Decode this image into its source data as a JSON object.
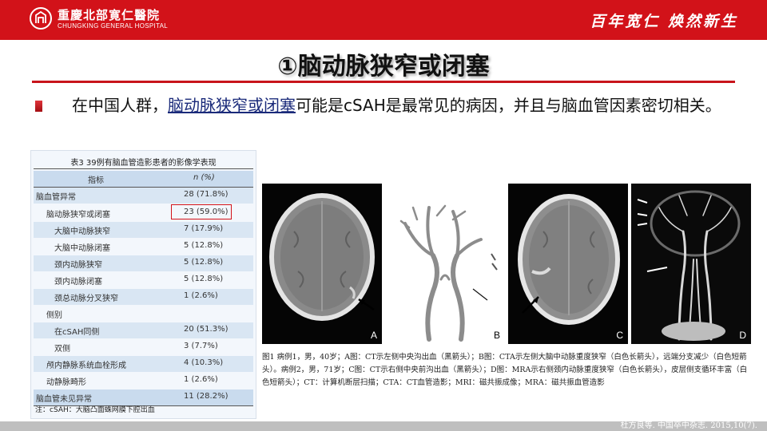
{
  "header": {
    "hospital_cn": "重慶北部寛仁醫院",
    "hospital_en": "CHUNGKING GENERAL HOSPITAL",
    "slogan": "百年宽仁  焕然新生"
  },
  "slide": {
    "title": "①脑动脉狭窄或闭塞",
    "bullet": {
      "pre": "在中国人群，",
      "highlight": "脑动脉狭窄或闭塞",
      "post": "可能是cSAH是最常见的病因，并且与脑血管因素密切相关。"
    }
  },
  "table": {
    "caption": "表3   39例有脑血管造影患者的影像学表现",
    "headers": [
      "指标",
      "n (%)"
    ],
    "rows": [
      {
        "label": "脑血管异常",
        "value": "28 (71.8%)"
      },
      {
        "label": "脑动脉狭窄或闭塞",
        "value": "23 (59.0%)"
      },
      {
        "label": "大脑中动脉狭窄",
        "value": "7 (17.9%)"
      },
      {
        "label": "大脑中动脉闭塞",
        "value": "5 (12.8%)"
      },
      {
        "label": "颈内动脉狭窄",
        "value": "5 (12.8%)"
      },
      {
        "label": "颈内动脉闭塞",
        "value": "5 (12.8%)"
      },
      {
        "label": "颈总动脉分叉狭窄",
        "value": "1 (2.6%)"
      },
      {
        "label": "侧别",
        "value": ""
      },
      {
        "label": "在cSAH同侧",
        "value": "20 (51.3%)"
      },
      {
        "label": "双侧",
        "value": "3 (7.7%)"
      },
      {
        "label": "颅内静脉系统血栓形成",
        "value": "4 (10.3%)"
      },
      {
        "label": "动静脉畸形",
        "value": "1 (2.6%)"
      },
      {
        "label": "脑血管未见异常",
        "value": "11 (28.2%)"
      }
    ],
    "note": "注：cSAH：大脑凸面蛛网膜下腔出血"
  },
  "figure": {
    "panels": [
      "A",
      "B",
      "C",
      "D"
    ],
    "caption": "图1    病例1，男，40岁；A图：CT示左侧中央沟出血（黑箭头）；B图：CTA示左侧大脑中动脉重度狭窄（白色长箭头），远端分支减少（白色短箭头）。病例2，男，71岁；C图：CT示右侧中央前沟出血（黑箭头）；D图：MRA示右侧颈内动脉重度狭窄（白色长箭头），皮层侧支循环丰富（白色短箭头）；CT：计算机断层扫描；CTA：CT血管造影；MRI：磁共振成像；MRA：磁共振血管造影"
  },
  "footer": {
    "credit": "杜方良等. 中国卒中杂志. 2015,10(7)."
  }
}
